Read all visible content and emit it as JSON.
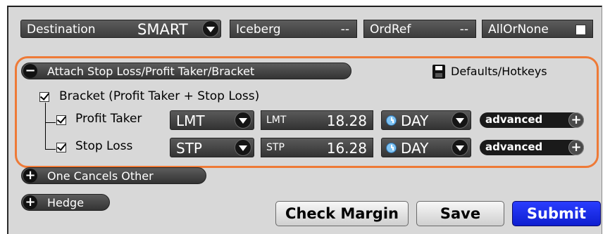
{
  "top_row": {
    "destination": {
      "label": "Destination",
      "value": "SMART"
    },
    "iceberg": {
      "label": "Iceberg",
      "value": "--"
    },
    "ordref": {
      "label": "OrdRef",
      "value": "--"
    },
    "allornone": {
      "label": "AllOrNone",
      "checked": false
    }
  },
  "attach_section": {
    "toggle": "−",
    "title": "Attach Stop Loss/Profit Taker/Bracket",
    "defaults_label": "Defaults/Hotkeys",
    "bracket": {
      "label": "Bracket (Profit Taker + Stop Loss)",
      "checked": true
    },
    "rows": [
      {
        "label": "Profit Taker",
        "checked": true,
        "order_type": "LMT",
        "price_label": "LMT",
        "price": "18.28",
        "tif": "DAY",
        "advanced": "advanced",
        "advanced_icon": "+"
      },
      {
        "label": "Stop Loss",
        "checked": true,
        "order_type": "STP",
        "price_label": "STP",
        "price": "16.28",
        "tif": "DAY",
        "advanced": "advanced",
        "advanced_icon": "+"
      }
    ]
  },
  "collapsed_sections": [
    {
      "toggle": "+",
      "title": "One Cancels Other"
    },
    {
      "toggle": "+",
      "title": "Hedge"
    }
  ],
  "buttons": {
    "check_margin": "Check Margin",
    "save": "Save",
    "submit": "Submit"
  },
  "colors": {
    "highlight_border": "#ee7a37",
    "submit_blue": "#1a2cf0",
    "panel_bg": "#d8d8d8"
  }
}
